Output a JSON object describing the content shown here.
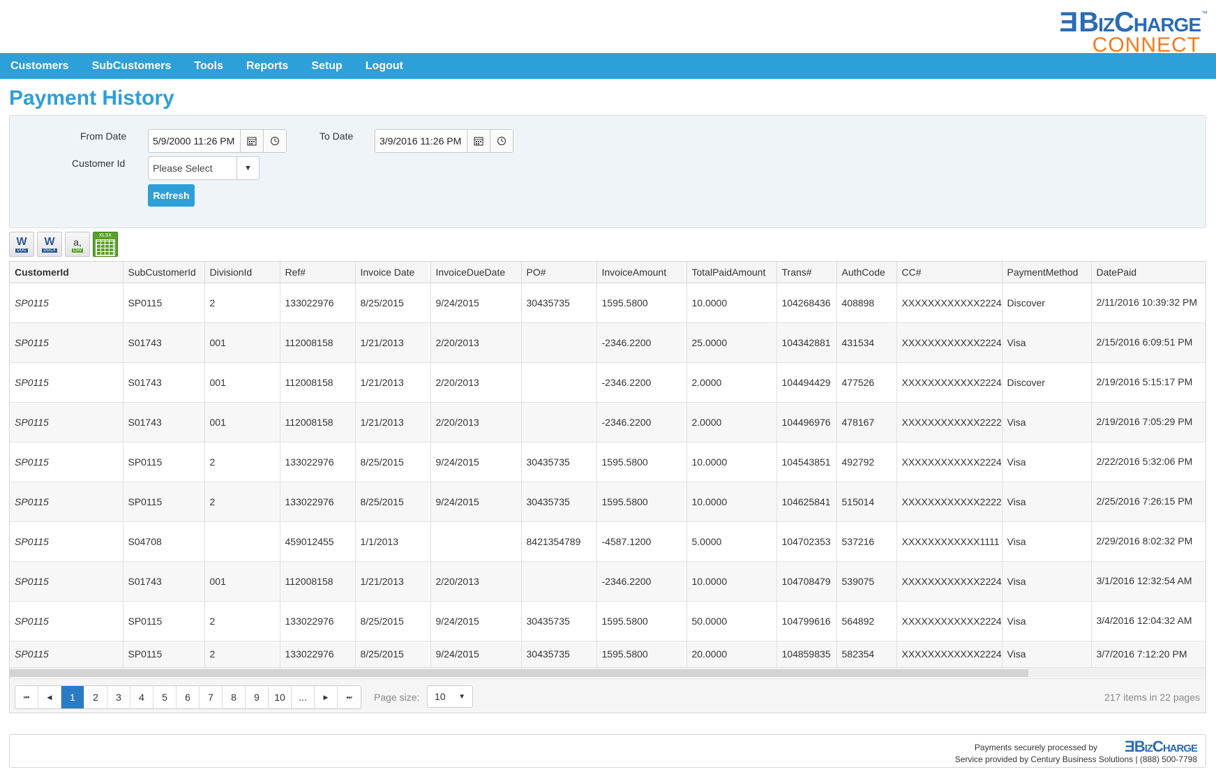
{
  "logo": {
    "brand": "BizCharge",
    "tm": "™",
    "sub": "CONNECT"
  },
  "nav": [
    "Customers",
    "SubCustomers",
    "Tools",
    "Reports",
    "Setup",
    "Logout"
  ],
  "page_title": "Payment History",
  "filters": {
    "from_label": "From Date",
    "from_value": "5/9/2000 11:26 PM",
    "to_label": "To Date",
    "to_value": "3/9/2016 11:26 PM",
    "customer_label": "Customer Id",
    "customer_value": "Please Select",
    "refresh_label": "Refresh"
  },
  "exports": [
    {
      "name": "export-doc-icon",
      "glyph": "W",
      "tag": "DOC"
    },
    {
      "name": "export-docx-icon",
      "glyph": "W",
      "tag": "DOCX"
    },
    {
      "name": "export-csv-icon",
      "glyph": "a,",
      "tag": "CSV"
    },
    {
      "name": "export-xlsx-icon",
      "glyph": "",
      "tag": "XLSX"
    }
  ],
  "grid": {
    "columns": [
      "CustomerId",
      "SubCustomerId",
      "DivisionId",
      "Ref#",
      "Invoice Date",
      "InvoiceDueDate",
      "PO#",
      "InvoiceAmount",
      "TotalPaidAmount",
      "Trans#",
      "AuthCode",
      "CC#",
      "PaymentMethod",
      "DatePaid"
    ],
    "rows": [
      [
        "SP0115",
        "SP0115",
        "2",
        "133022976",
        "8/25/2015",
        "9/24/2015",
        "30435735",
        "1595.5800",
        "10.0000",
        "104268436",
        "408898",
        "XXXXXXXXXXXX2224",
        "Discover",
        "2/11/2016 10:39:32 PM"
      ],
      [
        "SP0115",
        "S01743",
        "001",
        "112008158",
        "1/21/2013",
        "2/20/2013",
        "",
        "-2346.2200",
        "25.0000",
        "104342881",
        "431534",
        "XXXXXXXXXXXX2224",
        "Visa",
        "2/15/2016 6:09:51 PM"
      ],
      [
        "SP0115",
        "S01743",
        "001",
        "112008158",
        "1/21/2013",
        "2/20/2013",
        "",
        "-2346.2200",
        "2.0000",
        "104494429",
        "477526",
        "XXXXXXXXXXXX2224",
        "Discover",
        "2/19/2016 5:15:17 PM"
      ],
      [
        "SP0115",
        "S01743",
        "001",
        "112008158",
        "1/21/2013",
        "2/20/2013",
        "",
        "-2346.2200",
        "2.0000",
        "104496976",
        "478167",
        "XXXXXXXXXXXX2222",
        "Visa",
        "2/19/2016 7:05:29 PM"
      ],
      [
        "SP0115",
        "SP0115",
        "2",
        "133022976",
        "8/25/2015",
        "9/24/2015",
        "30435735",
        "1595.5800",
        "10.0000",
        "104543851",
        "492792",
        "XXXXXXXXXXXX2224",
        "Visa",
        "2/22/2016 5:32:06 PM"
      ],
      [
        "SP0115",
        "SP0115",
        "2",
        "133022976",
        "8/25/2015",
        "9/24/2015",
        "30435735",
        "1595.5800",
        "10.0000",
        "104625841",
        "515014",
        "XXXXXXXXXXXX2222",
        "Visa",
        "2/25/2016 7:26:15 PM"
      ],
      [
        "SP0115",
        "S04708",
        "",
        "459012455",
        "1/1/2013",
        "",
        "8421354789",
        "-4587.1200",
        "5.0000",
        "104702353",
        "537216",
        "XXXXXXXXXXXX1111",
        "Visa",
        "2/29/2016 8:02:32 PM"
      ],
      [
        "SP0115",
        "S01743",
        "001",
        "112008158",
        "1/21/2013",
        "2/20/2013",
        "",
        "-2346.2200",
        "10.0000",
        "104708479",
        "539075",
        "XXXXXXXXXXXX2224",
        "Visa",
        "3/1/2016 12:32:54 AM"
      ],
      [
        "SP0115",
        "SP0115",
        "2",
        "133022976",
        "8/25/2015",
        "9/24/2015",
        "30435735",
        "1595.5800",
        "50.0000",
        "104799616",
        "564892",
        "XXXXXXXXXXXX2224",
        "Visa",
        "3/4/2016 12:04:32 AM"
      ],
      [
        "SP0115",
        "SP0115",
        "2",
        "133022976",
        "8/25/2015",
        "9/24/2015",
        "30435735",
        "1595.5800",
        "20.0000",
        "104859835",
        "582354",
        "XXXXXXXXXXXX2224",
        "Visa",
        "3/7/2016 7:12:20 PM"
      ]
    ]
  },
  "pager": {
    "first": "⏮",
    "prev": "◀",
    "next": "▶",
    "last": "⏭",
    "pages": [
      "1",
      "2",
      "3",
      "4",
      "5",
      "6",
      "7",
      "8",
      "9",
      "10",
      "..."
    ],
    "current": "1",
    "page_size_label": "Page size:",
    "page_size": "10",
    "items_info": "217 items in 22 pages"
  },
  "footer": {
    "processed": "Payments securely processed by",
    "brand": "BizCharge",
    "service": "Service provided by Century Business Solutions  |  (888) 500-7798"
  },
  "colors": {
    "primary": "#2d9fd9",
    "brand_blue": "#2b6bb5",
    "brand_orange": "#f27a20",
    "pager_active": "#2b7bc4"
  }
}
